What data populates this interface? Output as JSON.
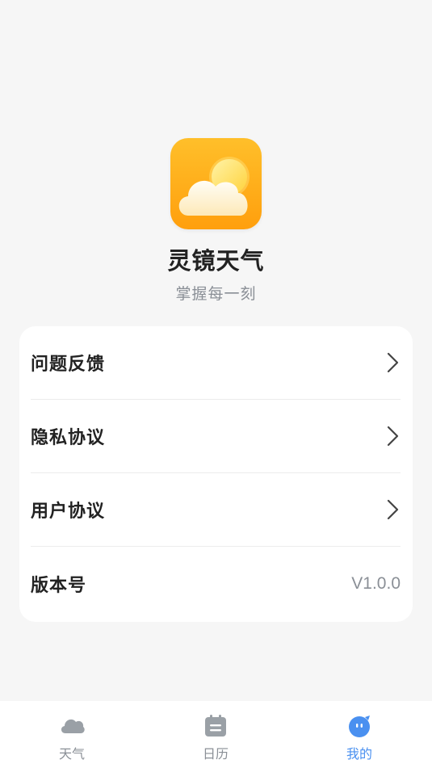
{
  "app": {
    "name": "灵镜天气",
    "slogan": "掌握每一刻",
    "logo_icon": "sun-behind-cloud-icon"
  },
  "menu": {
    "items": [
      {
        "label": "问题反馈",
        "icon": "chevron-right-icon"
      },
      {
        "label": "隐私协议",
        "icon": "chevron-right-icon"
      },
      {
        "label": "用户协议",
        "icon": "chevron-right-icon"
      },
      {
        "label": "版本号",
        "value": "V1.0.0"
      }
    ]
  },
  "bottom_nav": {
    "tabs": [
      {
        "label": "天气",
        "icon": "cloud-icon",
        "active": false
      },
      {
        "label": "日历",
        "icon": "calendar-icon",
        "active": false
      },
      {
        "label": "我的",
        "icon": "profile-face-icon",
        "active": true
      }
    ]
  },
  "colors": {
    "background": "#f6f6f6",
    "accent": "#4a90f0",
    "logo": "#ffa912",
    "muted_text": "#8a8f96"
  }
}
